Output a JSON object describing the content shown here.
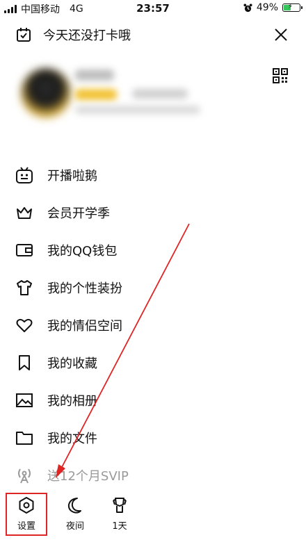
{
  "status_bar": {
    "carrier": "中国移动",
    "network": "4G",
    "time": "23:57",
    "battery": "49%",
    "battery_level": 0.49,
    "accent_battery": "#34c759"
  },
  "checkin": {
    "text": "今天还没打卡哦"
  },
  "menu": [
    {
      "label": "开播啦鹅",
      "icon": "tv-icon"
    },
    {
      "label": "会员开学季",
      "icon": "crown-icon"
    },
    {
      "label": "我的QQ钱包",
      "icon": "wallet-icon"
    },
    {
      "label": "我的个性装扮",
      "icon": "tshirt-icon"
    },
    {
      "label": "我的情侣空间",
      "icon": "heart-icon"
    },
    {
      "label": "我的收藏",
      "icon": "bookmark-icon"
    },
    {
      "label": "我的相册",
      "icon": "image-icon"
    },
    {
      "label": "我的文件",
      "icon": "folder-icon"
    },
    {
      "label": "送12个月SVIP",
      "icon": "broadcast-icon"
    }
  ],
  "toolbar": {
    "settings": "设置",
    "night": "夜间",
    "days": "1天"
  },
  "colors": {
    "annotation_red": "#e02424",
    "promo_gray": "#9a9a9a"
  }
}
